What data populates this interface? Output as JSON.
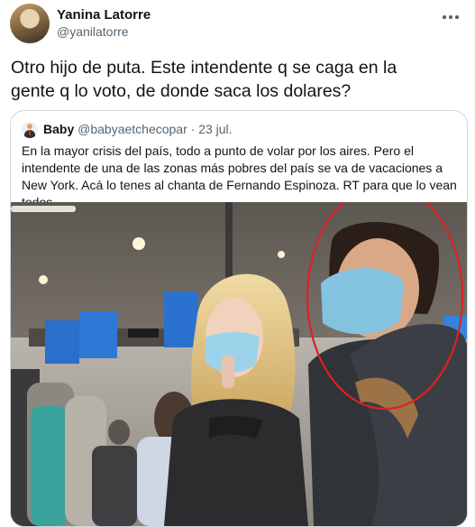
{
  "author": {
    "name": "Yanina Latorre",
    "handle": "@yanilatorre"
  },
  "tweet": {
    "text": "Otro hijo de puta. Este intendente q se caga en la\ngente q lo voto, de donde saca los dolares?"
  },
  "quote": {
    "name": "Baby",
    "handle": "@babyaetchecopar",
    "separator": "·",
    "date": "23 jul.",
    "text": "En la mayor crisis del país, todo a punto de volar por los aires. Pero el intendente de una de las zonas más pobres del país se va de vacaciones a New York. Acá lo tenes al chanta de Fernando Espinoza. RT para que lo vean todos."
  },
  "icons": {
    "more": "more-horizontal-icon",
    "quote_avatar": "man-in-suit-icon"
  },
  "colors": {
    "text": "#0f1419",
    "secondary": "#536471",
    "border": "#cfd9de",
    "circle": "#e02020"
  }
}
